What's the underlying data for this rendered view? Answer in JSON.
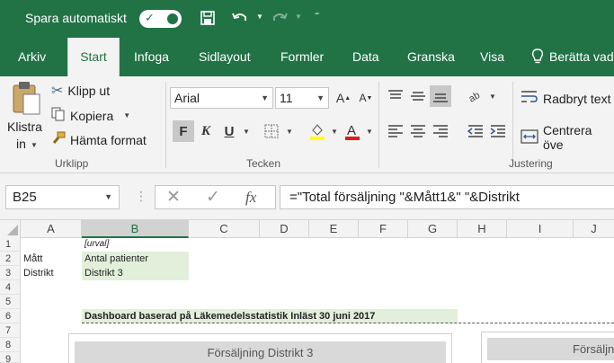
{
  "titlebar": {
    "autosave_label": "Spara automatiskt",
    "accent": "#217346"
  },
  "tabs": [
    {
      "label": "Arkiv"
    },
    {
      "label": "Start"
    },
    {
      "label": "Infoga"
    },
    {
      "label": "Sidlayout"
    },
    {
      "label": "Formler"
    },
    {
      "label": "Data"
    },
    {
      "label": "Granska"
    },
    {
      "label": "Visa"
    },
    {
      "label": "Berätta vad"
    }
  ],
  "ribbon": {
    "clipboard": {
      "paste_line1": "Klistra",
      "paste_line2": "in",
      "cut": "Klipp ut",
      "copy": "Kopiera",
      "format_painter": "Hämta format",
      "group": "Urklipp"
    },
    "font": {
      "name": "Arial",
      "size": "11",
      "bold": "F",
      "italic": "K",
      "underline": "U",
      "group": "Tecken"
    },
    "alignment": {
      "wrap": "Radbryt text",
      "merge": "Centrera öve",
      "group": "Justering"
    }
  },
  "formula_bar": {
    "name_box": "B25",
    "formula": "=\"Total försäljning \"&Mått1&\" \"&Distrikt"
  },
  "columns": [
    "A",
    "B",
    "C",
    "D",
    "E",
    "F",
    "G",
    "H",
    "I",
    "J"
  ],
  "rows": [
    "1",
    "2",
    "3",
    "4",
    "5",
    "6",
    "7",
    "8",
    "9"
  ],
  "cells": {
    "B1": "[urval]",
    "A2": "Mått",
    "B2": "Antal patienter",
    "A3": "Distrikt",
    "B3": "Distrikt 3",
    "B6": "Dashboard baserad på Läkemedelsstatistik Inläst 30 juni 2017"
  },
  "charts": [
    {
      "title": "Försäljning Distrikt 3"
    },
    {
      "title": "Försäljn"
    }
  ]
}
